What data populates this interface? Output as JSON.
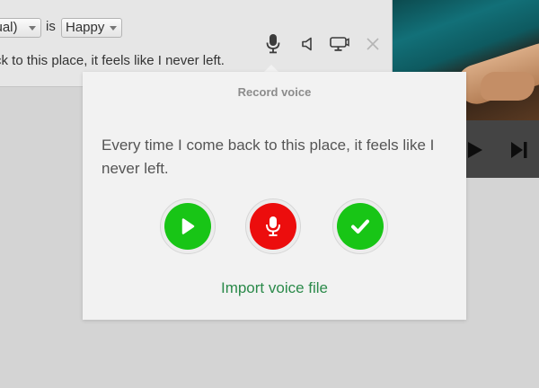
{
  "editor": {
    "condition_select": "sual)",
    "is_word": "is",
    "emotion_select": "Happy",
    "line_text": "ck to this place, it feels like I never left."
  },
  "toolbar": {
    "icons": [
      "microphone-icon",
      "speaker-icon",
      "camera-icon",
      "close-icon"
    ]
  },
  "video": {
    "controls": [
      "play-icon",
      "skip-next-icon"
    ]
  },
  "popup": {
    "title": "Record voice",
    "sentence": "Every time I come back to this place, it feels like I never left.",
    "buttons": {
      "play": "play-icon",
      "record": "microphone-icon",
      "confirm": "checkmark-icon"
    },
    "import_link": "Import voice file"
  },
  "colors": {
    "green": "#18c516",
    "red": "#ec0d0d",
    "link": "#2b8a4a"
  }
}
